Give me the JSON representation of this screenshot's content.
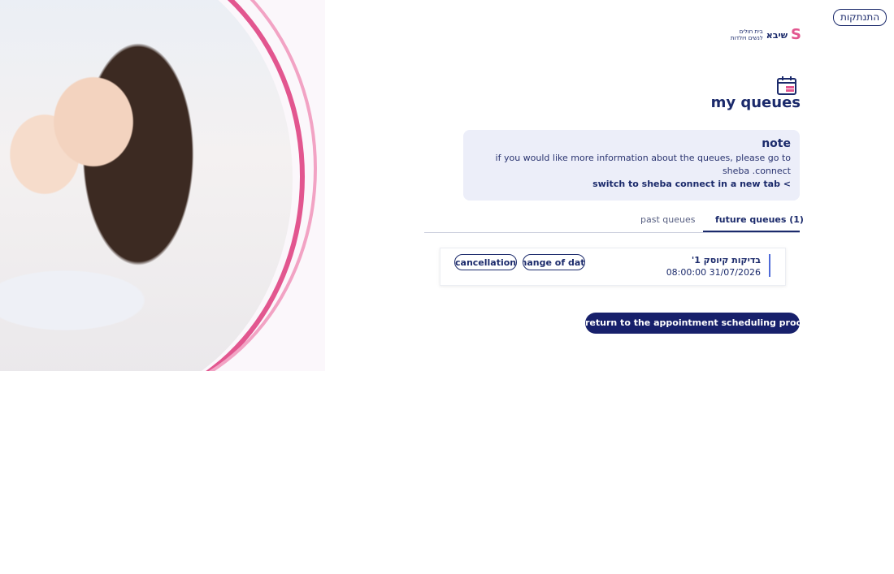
{
  "header": {
    "logout_label": "התנתקות",
    "logo": {
      "main": "שיבא",
      "line1": "בית חולים",
      "line2": "לנשים ויולדות",
      "symbol": "S"
    }
  },
  "page": {
    "title": "my queues",
    "title_icon": "calendar-icon"
  },
  "note": {
    "title": "note",
    "body": "if you would like more information about the queues, please go to sheba .connect",
    "link_label": "switch to sheba connect in a new tab <"
  },
  "tabs": [
    {
      "label": "future queues (1)",
      "active": true
    },
    {
      "label": "past queues",
      "active": false
    }
  ],
  "appointments": [
    {
      "name": "בדיקות קיוסק 1'",
      "datetime": "08:00:00 31/07/2026",
      "change_label": "change of date",
      "cancel_label": "cancellation"
    }
  ],
  "return_button_label": "return to the appointment scheduling process",
  "colors": {
    "brand_navy": "#1b2a6b",
    "accent_pink": "#e2568f",
    "note_bg": "#eceef9",
    "button_bg": "#17206b"
  }
}
